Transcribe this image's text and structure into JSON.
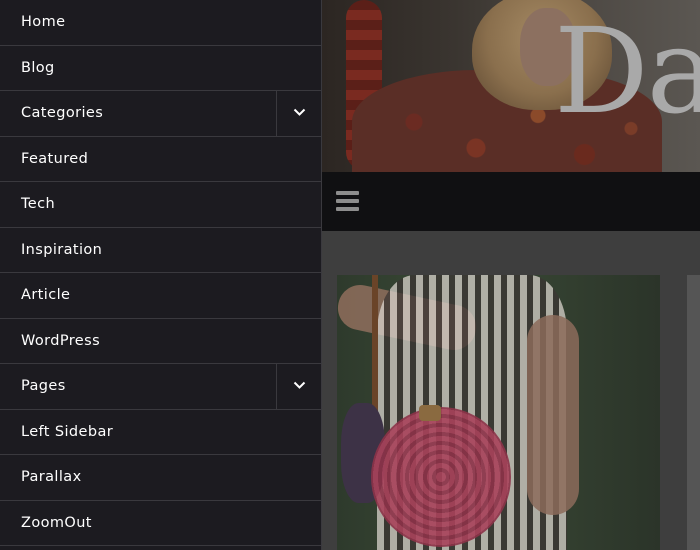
{
  "menu": {
    "items": [
      {
        "label": "Home",
        "has_submenu": false
      },
      {
        "label": "Blog",
        "has_submenu": false
      },
      {
        "label": "Categories",
        "has_submenu": true
      },
      {
        "label": "Featured",
        "has_submenu": false
      },
      {
        "label": "Tech",
        "has_submenu": false
      },
      {
        "label": "Inspiration",
        "has_submenu": false
      },
      {
        "label": "Article",
        "has_submenu": false
      },
      {
        "label": "WordPress",
        "has_submenu": false
      },
      {
        "label": "Pages",
        "has_submenu": true
      },
      {
        "label": "Left Sidebar",
        "has_submenu": false
      },
      {
        "label": "Parallax",
        "has_submenu": false
      },
      {
        "label": "ZoomOut",
        "has_submenu": false
      }
    ],
    "submenu_icon": "chevron-down-icon"
  },
  "header": {
    "logo_text": "Da",
    "menu_icon": "hamburger-menu-icon"
  },
  "colors": {
    "menu_background": "#1c1b20",
    "menu_divider": "#3a393e",
    "menu_text": "#ffffff",
    "navbar_background": "#101012",
    "overlay_content": "#3e3e3e"
  }
}
